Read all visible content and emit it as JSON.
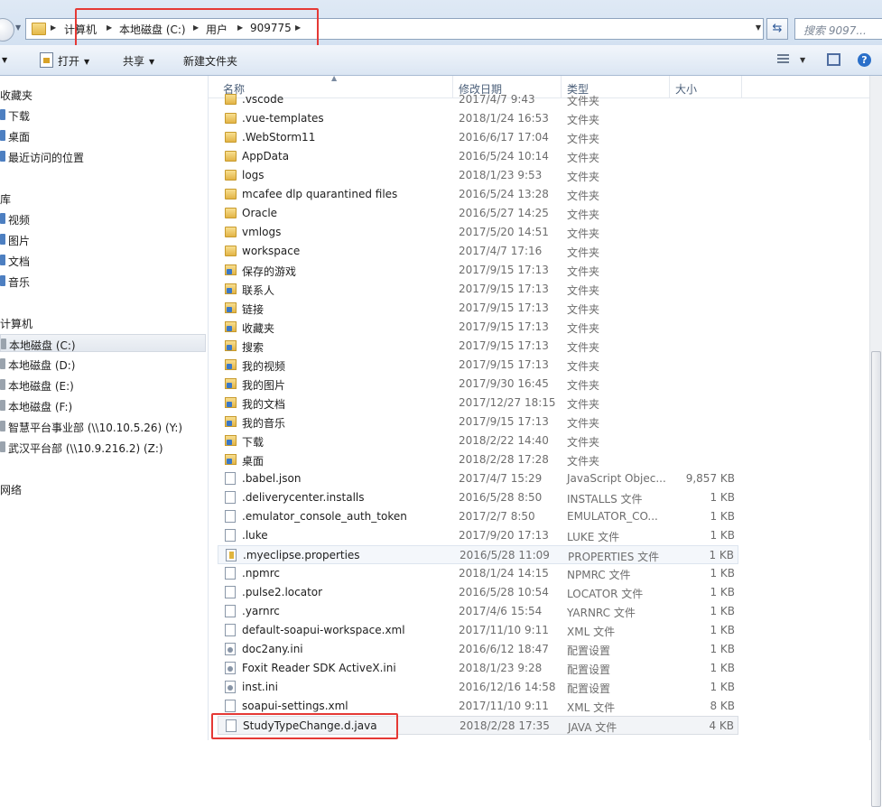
{
  "colors": {
    "annotation": "#e53935",
    "toolbar": "#dbe6f3",
    "folder": "#e2b446"
  },
  "address": {
    "crumbs": [
      "计算机",
      "本地磁盘 (C:)",
      "用户",
      "909775"
    ],
    "search_placeholder": "搜索 9097..."
  },
  "toolbar": {
    "open": "打开",
    "share": "共享",
    "new_folder": "新建文件夹"
  },
  "nav": {
    "favorites": "收藏夹",
    "fav_items": [
      "下载",
      "桌面",
      "最近访问的位置"
    ],
    "libraries": "库",
    "lib_items": [
      "视频",
      "图片",
      "文档",
      "音乐"
    ],
    "computer": "计算机",
    "drives": [
      "本地磁盘 (C:)",
      "本地磁盘 (D:)",
      "本地磁盘 (E:)",
      "本地磁盘 (F:)",
      "智慧平台事业部 (\\\\10.10.5.26) (Y:)",
      "武汉平台部 (\\\\10.9.216.2) (Z:)"
    ],
    "network": "网络"
  },
  "columns": {
    "name": "名称",
    "date": "修改日期",
    "type": "类型",
    "size": "大小"
  },
  "files": [
    {
      "name": ".vscode",
      "date": "2017/4/7 9:43",
      "type": "文件夹",
      "size": "",
      "icon": "folder"
    },
    {
      "name": ".vue-templates",
      "date": "2018/1/24 16:53",
      "type": "文件夹",
      "size": "",
      "icon": "folder"
    },
    {
      "name": ".WebStorm11",
      "date": "2016/6/17 17:04",
      "type": "文件夹",
      "size": "",
      "icon": "folder"
    },
    {
      "name": "AppData",
      "date": "2016/5/24 10:14",
      "type": "文件夹",
      "size": "",
      "icon": "folder"
    },
    {
      "name": "logs",
      "date": "2018/1/23 9:53",
      "type": "文件夹",
      "size": "",
      "icon": "folder"
    },
    {
      "name": "mcafee dlp quarantined files",
      "date": "2016/5/24 13:28",
      "type": "文件夹",
      "size": "",
      "icon": "folder"
    },
    {
      "name": "Oracle",
      "date": "2016/5/27 14:25",
      "type": "文件夹",
      "size": "",
      "icon": "folder"
    },
    {
      "name": "vmlogs",
      "date": "2017/5/20 14:51",
      "type": "文件夹",
      "size": "",
      "icon": "folder"
    },
    {
      "name": "workspace",
      "date": "2017/4/7 17:16",
      "type": "文件夹",
      "size": "",
      "icon": "folder"
    },
    {
      "name": "保存的游戏",
      "date": "2017/9/15 17:13",
      "type": "文件夹",
      "size": "",
      "icon": "special"
    },
    {
      "name": "联系人",
      "date": "2017/9/15 17:13",
      "type": "文件夹",
      "size": "",
      "icon": "special"
    },
    {
      "name": "链接",
      "date": "2017/9/15 17:13",
      "type": "文件夹",
      "size": "",
      "icon": "special"
    },
    {
      "name": "收藏夹",
      "date": "2017/9/15 17:13",
      "type": "文件夹",
      "size": "",
      "icon": "special"
    },
    {
      "name": "搜索",
      "date": "2017/9/15 17:13",
      "type": "文件夹",
      "size": "",
      "icon": "special"
    },
    {
      "name": "我的视频",
      "date": "2017/9/15 17:13",
      "type": "文件夹",
      "size": "",
      "icon": "special"
    },
    {
      "name": "我的图片",
      "date": "2017/9/30 16:45",
      "type": "文件夹",
      "size": "",
      "icon": "special"
    },
    {
      "name": "我的文档",
      "date": "2017/12/27 18:15",
      "type": "文件夹",
      "size": "",
      "icon": "special"
    },
    {
      "name": "我的音乐",
      "date": "2017/9/15 17:13",
      "type": "文件夹",
      "size": "",
      "icon": "special"
    },
    {
      "name": "下载",
      "date": "2018/2/22 14:40",
      "type": "文件夹",
      "size": "",
      "icon": "special"
    },
    {
      "name": "桌面",
      "date": "2018/2/28 17:28",
      "type": "文件夹",
      "size": "",
      "icon": "special"
    },
    {
      "name": ".babel.json",
      "date": "2017/4/7 15:29",
      "type": "JavaScript Objec...",
      "size": "9,857 KB",
      "icon": "file"
    },
    {
      "name": ".deliverycenter.installs",
      "date": "2016/5/28 8:50",
      "type": "INSTALLS 文件",
      "size": "1 KB",
      "icon": "file"
    },
    {
      "name": ".emulator_console_auth_token",
      "date": "2017/2/7 8:50",
      "type": "EMULATOR_CO...",
      "size": "1 KB",
      "icon": "file"
    },
    {
      "name": ".luke",
      "date": "2017/9/20 17:13",
      "type": "LUKE 文件",
      "size": "1 KB",
      "icon": "file"
    },
    {
      "name": ".myeclipse.properties",
      "date": "2016/5/28 11:09",
      "type": "PROPERTIES 文件",
      "size": "1 KB",
      "icon": "props"
    },
    {
      "name": ".npmrc",
      "date": "2018/1/24 14:15",
      "type": "NPMRC 文件",
      "size": "1 KB",
      "icon": "file"
    },
    {
      "name": ".pulse2.locator",
      "date": "2016/5/28 10:54",
      "type": "LOCATOR 文件",
      "size": "1 KB",
      "icon": "file"
    },
    {
      "name": ".yarnrc",
      "date": "2017/4/6 15:54",
      "type": "YARNRC 文件",
      "size": "1 KB",
      "icon": "file"
    },
    {
      "name": "default-soapui-workspace.xml",
      "date": "2017/11/10 9:11",
      "type": "XML 文件",
      "size": "1 KB",
      "icon": "file"
    },
    {
      "name": "doc2any.ini",
      "date": "2016/6/12 18:47",
      "type": "配置设置",
      "size": "1 KB",
      "icon": "config"
    },
    {
      "name": "Foxit Reader SDK ActiveX.ini",
      "date": "2018/1/23 9:28",
      "type": "配置设置",
      "size": "1 KB",
      "icon": "config"
    },
    {
      "name": "inst.ini",
      "date": "2016/12/16 14:58",
      "type": "配置设置",
      "size": "1 KB",
      "icon": "config"
    },
    {
      "name": "soapui-settings.xml",
      "date": "2017/11/10 9:11",
      "type": "XML 文件",
      "size": "8 KB",
      "icon": "file"
    },
    {
      "name": "StudyTypeChange.d.java",
      "date": "2018/2/28 17:35",
      "type": "JAVA 文件",
      "size": "4 KB",
      "icon": "file"
    }
  ]
}
